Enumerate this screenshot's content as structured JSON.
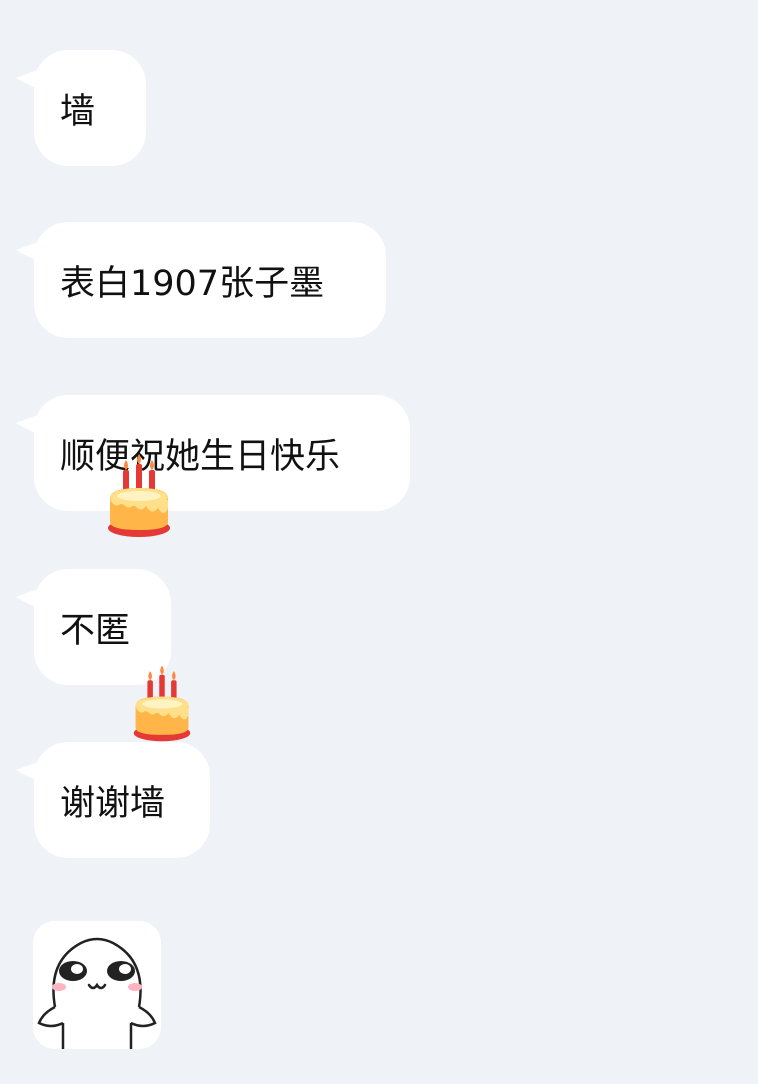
{
  "messages": [
    {
      "text": "墙"
    },
    {
      "text": "表白1907张子墨"
    },
    {
      "text": "顺便祝她生日快乐"
    },
    {
      "text": "不匿"
    },
    {
      "text": "谢谢墙"
    }
  ],
  "emojis": {
    "cake_1": "birthday-cake-icon",
    "cake_2": "birthday-cake-icon"
  },
  "sticker": {
    "icon": "blushing-face-sticker-icon"
  },
  "colors": {
    "background": "#eff2f6",
    "bubble": "#ffffff",
    "text": "#111111"
  }
}
